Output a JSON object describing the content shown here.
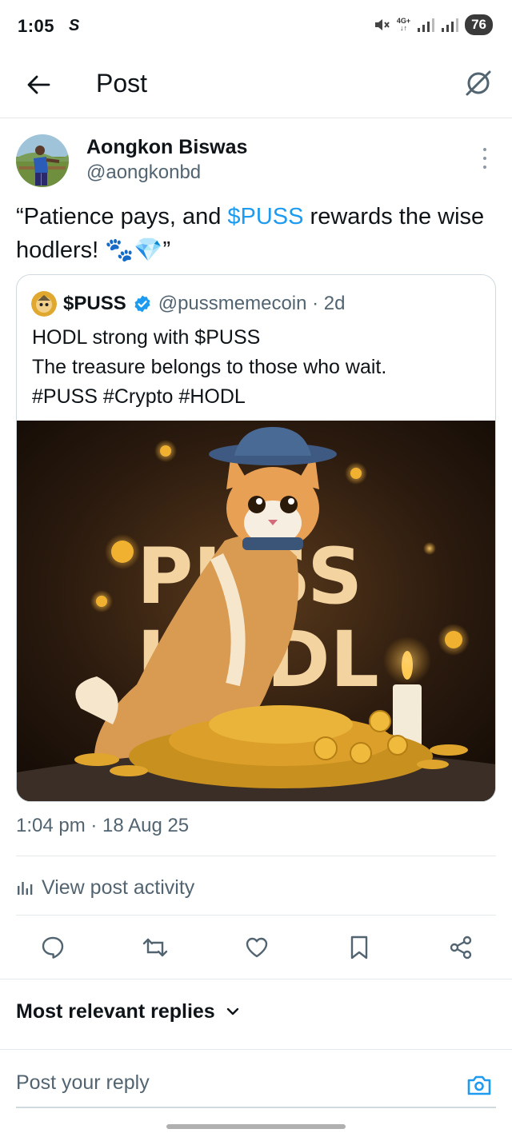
{
  "status_bar": {
    "time": "1:05",
    "carrier_icon": "S",
    "network": "4G+",
    "battery": "76"
  },
  "header": {
    "title": "Post"
  },
  "post": {
    "author_name": "Aongkon Biswas",
    "author_handle": "@aongkonbd",
    "text_before": "“Patience pays, and ",
    "cashtag": "$PUSS",
    "text_after": " rewards the wise hodlers! 🐾💎”",
    "timestamp": "1:04 pm · 18 Aug 25"
  },
  "quoted_post": {
    "name": "$PUSS",
    "handle": "@pussmemecoin · 2d",
    "lines": [
      "HODL strong with $PUSS",
      "The treasure belongs to those who wait.",
      "#PUSS #Crypto #HODL"
    ],
    "image_text_line1": "PUSS",
    "image_text_line2": "HODL"
  },
  "activity": {
    "label": "View post activity"
  },
  "actions": {
    "icons": [
      "reply-icon",
      "repost-icon",
      "like-icon",
      "bookmark-icon",
      "share-icon"
    ]
  },
  "replies": {
    "sort_label": "Most relevant replies"
  },
  "reply_box": {
    "placeholder": "Post your reply"
  },
  "colors": {
    "accent": "#1d9bf0",
    "secondary_text": "#536471",
    "border": "#cfd9de"
  }
}
